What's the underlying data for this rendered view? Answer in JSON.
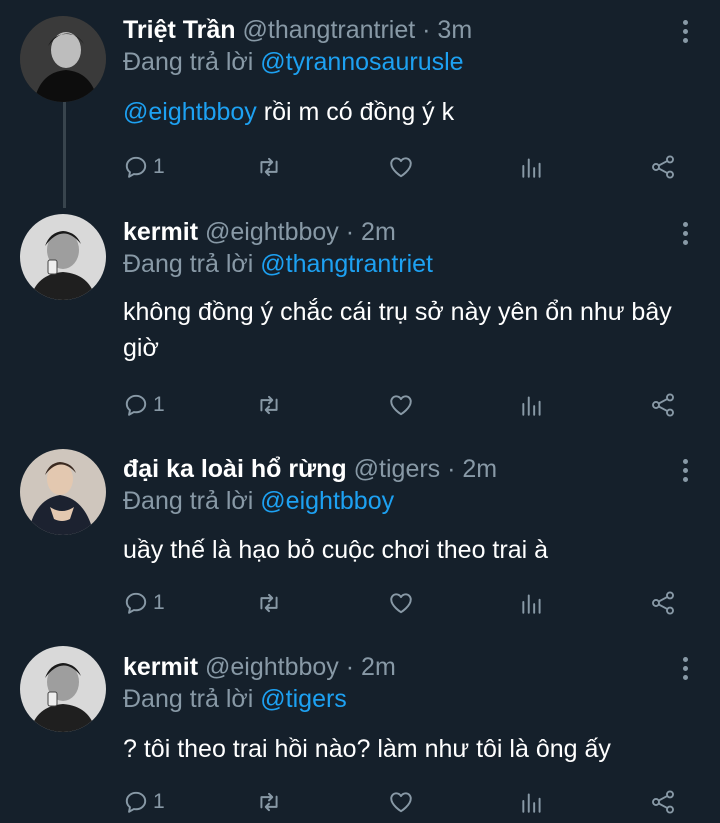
{
  "tweets": [
    {
      "name": "Triệt Trần",
      "handle": "@thangtrantriet",
      "time": "· 3m",
      "reply_prefix": "Đang trả lời",
      "reply_to": "@tyrannosaurusle",
      "text_mention": "@eightbboy",
      "text": " rồi m có đồng ý k",
      "reply_count": "1"
    },
    {
      "name": "kermit",
      "handle": "@eightbboy",
      "time": "· 2m",
      "reply_prefix": "Đang trả lời",
      "reply_to": "@thangtrantriet",
      "text_mention": "",
      "text": "không đồng ý chắc cái trụ sở này yên ổn như bây giờ",
      "reply_count": "1"
    },
    {
      "name": "đại ka loài hổ rừng",
      "handle": "@tigers",
      "time": "· 2m",
      "reply_prefix": "Đang trả lời",
      "reply_to": "@eightbboy",
      "text_mention": "",
      "text": "uầy thế là hạo bỏ cuộc chơi theo trai à",
      "reply_count": "1"
    },
    {
      "name": "kermit",
      "handle": "@eightbboy",
      "time": "· 2m",
      "reply_prefix": "Đang trả lời",
      "reply_to": "@tigers",
      "text_mention": "",
      "text": "? tôi theo trai hồi nào? làm như tôi là ông ấy",
      "reply_count": "1"
    }
  ],
  "icons": {
    "more": "more-vertical-icon",
    "reply": "reply-bubble-icon",
    "retweet": "retweet-icon",
    "like": "heart-icon",
    "analytics": "analytics-icon",
    "share": "share-icon"
  },
  "colors": {
    "background": "#15202b",
    "text": "#ffffff",
    "muted": "#8899a6",
    "link": "#1da1f2",
    "thread_line": "#38444d"
  }
}
